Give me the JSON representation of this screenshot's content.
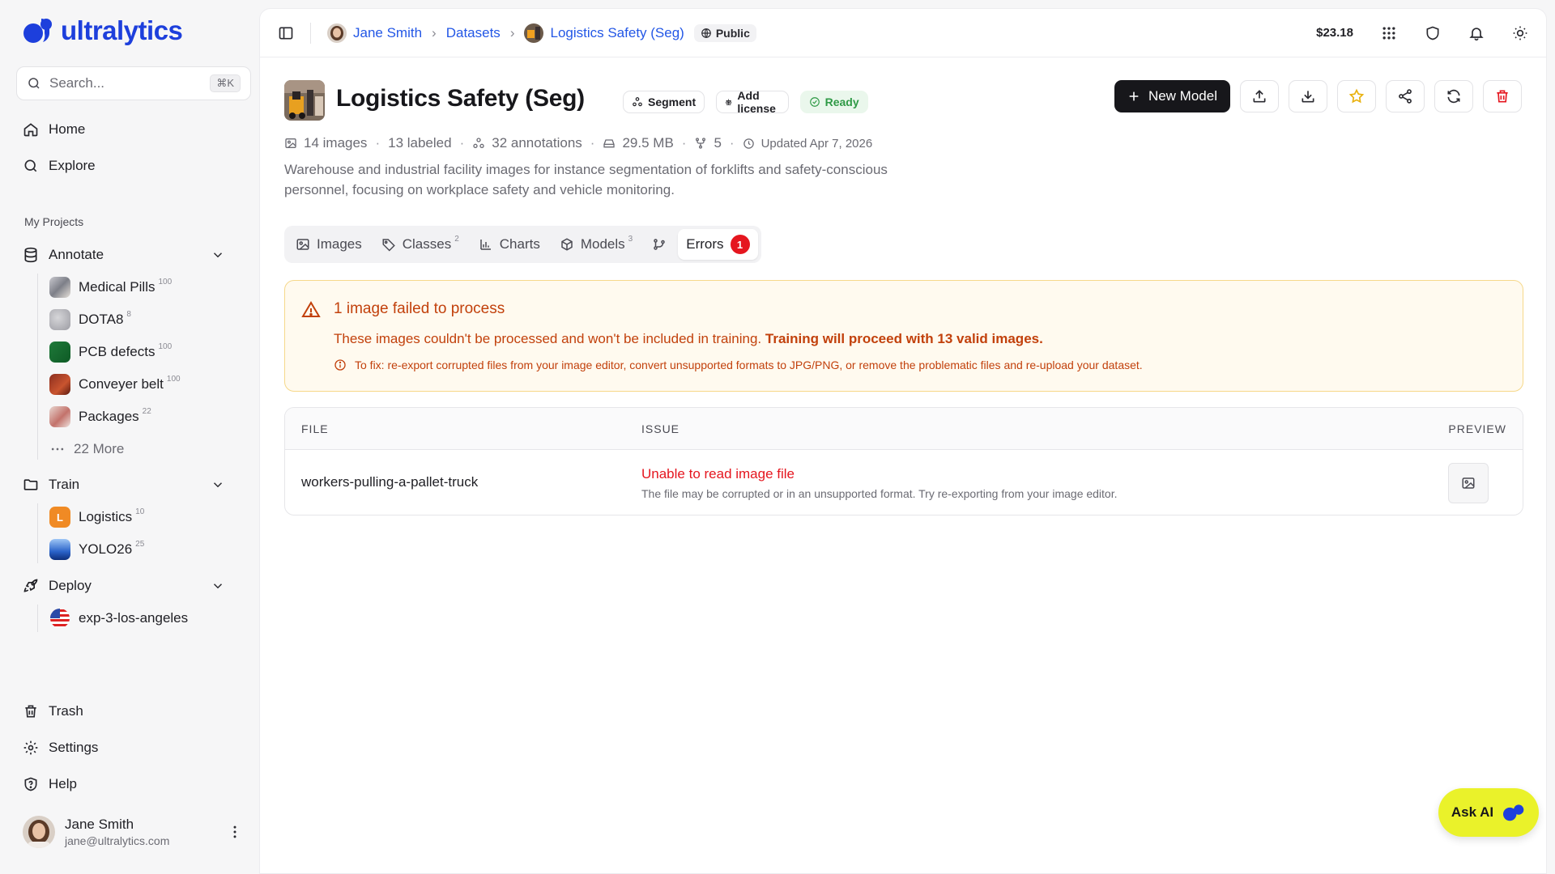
{
  "app": {
    "name": "ultralytics"
  },
  "search": {
    "placeholder": "Search...",
    "shortcut": "⌘K"
  },
  "nav": {
    "home": "Home",
    "explore": "Explore"
  },
  "projects_label": "My Projects",
  "annotate": {
    "label": "Annotate",
    "items": [
      {
        "label": "Medical Pills",
        "count": "100"
      },
      {
        "label": "DOTA8",
        "count": "8"
      },
      {
        "label": "PCB defects",
        "count": "100"
      },
      {
        "label": "Conveyer belt",
        "count": "100"
      },
      {
        "label": "Packages",
        "count": "22"
      }
    ],
    "more": "22 More"
  },
  "train": {
    "label": "Train",
    "items": [
      {
        "label": "Logistics",
        "count": "10",
        "initial": "L"
      },
      {
        "label": "YOLO26",
        "count": "25"
      }
    ]
  },
  "deploy": {
    "label": "Deploy",
    "items": [
      {
        "label": "exp-3-los-angeles"
      }
    ]
  },
  "bottom_nav": {
    "trash": "Trash",
    "settings": "Settings",
    "help": "Help"
  },
  "user": {
    "name": "Jane Smith",
    "email": "jane@ultralytics.com"
  },
  "breadcrumb": {
    "user": "Jane Smith",
    "section": "Datasets",
    "dataset": "Logistics Safety (Seg)",
    "visibility": "Public"
  },
  "balance": "$23.18",
  "dataset": {
    "title": "Logistics Safety (Seg)",
    "badges": {
      "task": "Segment",
      "license": "Add license",
      "status": "Ready"
    },
    "meta": {
      "images": "14 images",
      "labeled": "13 labeled",
      "annotations": "32 annotations",
      "size": "29.5 MB",
      "forks": "5",
      "updated": "Updated Apr 7, 2026"
    },
    "description": "Warehouse and industrial facility images for instance segmentation of forklifts and safety-conscious personnel, focusing on workplace safety and vehicle monitoring."
  },
  "actions": {
    "new_model": "New Model"
  },
  "tabs": [
    {
      "label": "Images"
    },
    {
      "label": "Classes",
      "count": "2"
    },
    {
      "label": "Charts"
    },
    {
      "label": "Models",
      "count": "3"
    },
    {
      "label": "Errors",
      "count": "1"
    }
  ],
  "alert": {
    "title": "1 image failed to process",
    "body": "These images couldn't be processed and won't be included in training.",
    "body_strong": "Training will proceed with 13 valid images.",
    "fix": "To fix: re-export corrupted files from your image editor, convert unsupported formats to JPG/PNG, or remove the problematic files and re-upload your dataset."
  },
  "errors_table": {
    "headers": {
      "file": "FILE",
      "issue": "ISSUE",
      "preview": "PREVIEW"
    },
    "rows": [
      {
        "file": "workers-pulling-a-pallet-truck",
        "issue_title": "Unable to read image file",
        "issue_detail": "The file may be corrupted or in an unsupported format. Try re-exporting from your image editor."
      }
    ]
  },
  "ask_ai": "Ask AI",
  "colors": {
    "brand": "#1d3fdc",
    "link": "#2357e6",
    "error": "#e5161f",
    "warning": "#c2410c",
    "ready": "#2f9a46",
    "ask_ai": "#eaf22a"
  }
}
